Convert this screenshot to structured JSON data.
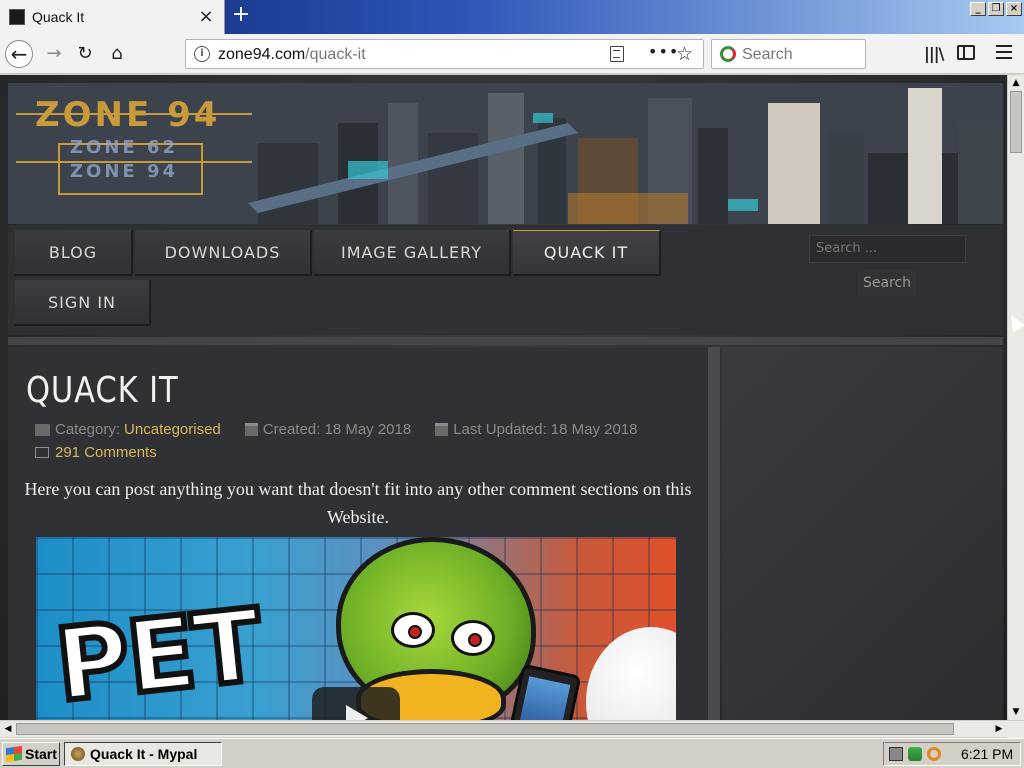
{
  "browser": {
    "tab_title": "Quack It",
    "new_tab_label": "+",
    "close_tab_label": "×",
    "url_domain": "zone94.com",
    "url_path": "/quack-it",
    "search_placeholder": "Search",
    "window_buttons": [
      "_",
      "❐",
      "×"
    ]
  },
  "site": {
    "logo_main": "ZONE 94",
    "logo_sub1": "ZONE 62",
    "logo_sub2": "ZONE 94",
    "accent_color": "#c99a3a",
    "link_color": "#d9b75a",
    "menu": {
      "blog": "BLOG",
      "downloads": "DOWNLOADS",
      "image_gallery": "IMAGE GALLERY",
      "quack_it": "QUACK IT",
      "sign_in": "SIGN IN"
    },
    "search": {
      "placeholder": "Search ...",
      "button": "Search"
    }
  },
  "article": {
    "title": "QUACK IT",
    "category_label": "Category:",
    "category_value": "Uncategorised",
    "created": "Created: 18 May 2018",
    "updated": "Last Updated: 18 May 2018",
    "comments": "291 Comments",
    "intro": "Here you can post anything you want that doesn't fit into any other comment sections on this Website.",
    "video_text": "PET"
  },
  "taskbar": {
    "start_label": "Start",
    "task_label": "Quack It - Mypal",
    "clock": "6:21 PM"
  }
}
